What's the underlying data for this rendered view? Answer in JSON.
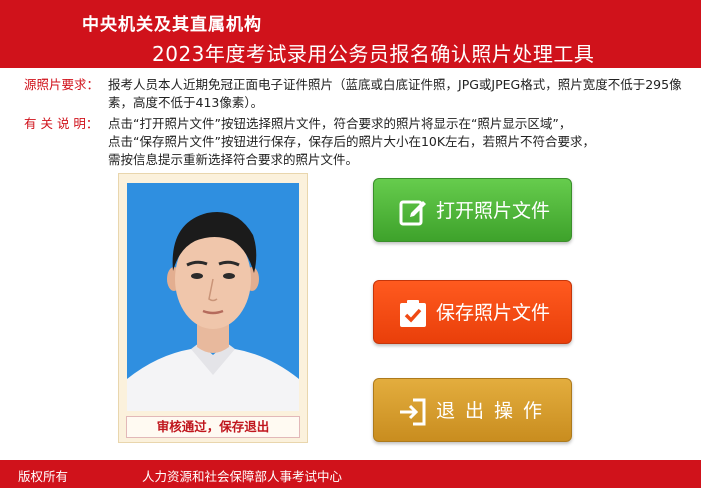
{
  "header": {
    "org": "中央机关及其直属机构",
    "title": "2023年度考试录用公务员报名确认照片处理工具"
  },
  "info": {
    "requirement_label": "源照片要求：",
    "requirement_text": "报考人员本人近期免冠正面电子证件照片（蓝底或白底证件照，JPG或JPEG格式，照片宽度不低于295像素，高度不低于413像素）。",
    "notes_label": "有 关 说 明：",
    "notes_lines": [
      "点击“打开照片文件”按钮选择照片文件，符合要求的照片将显示在“照片显示区域”，",
      "点击“保存照片文件”按钮进行保存，保存后的照片大小在10K左右，若照片不符合要求，",
      "需按信息提示重新选择符合要求的照片文件。"
    ]
  },
  "photo": {
    "status": "审核通过，保存退出",
    "background_color": "#2f8fe0"
  },
  "buttons": {
    "open": {
      "label": "打开照片文件",
      "icon": "edit-icon",
      "color": "#4caf3a"
    },
    "save": {
      "label": "保存照片文件",
      "icon": "checkbox-check-icon",
      "color": "#f04a14"
    },
    "exit": {
      "label": "退出操作",
      "icon": "exit-arrow-icon",
      "color": "#d49a2a"
    }
  },
  "footer": {
    "copyright": "版权所有",
    "organization": "人力资源和社会保障部人事考试中心"
  },
  "colors": {
    "brand_red": "#d0121b",
    "label_red": "#d0121b"
  }
}
